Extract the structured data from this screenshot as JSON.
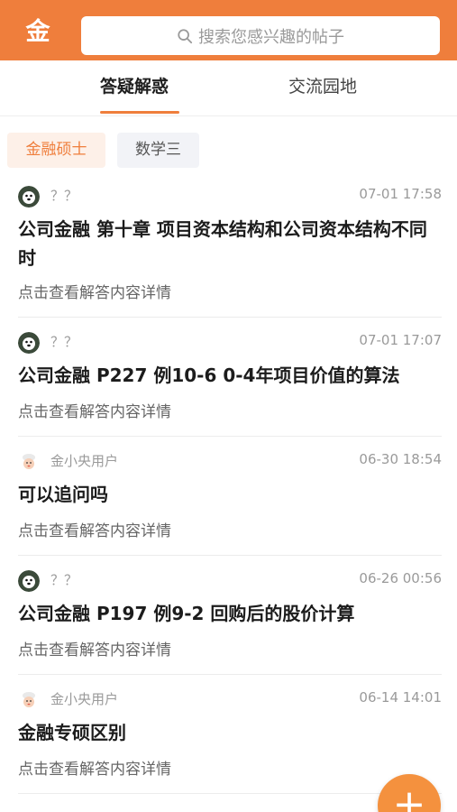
{
  "header": {
    "logo_text": "金",
    "search_placeholder": "搜索您感兴趣的帖子",
    "brand_color": "#ef7e3c"
  },
  "tabs": [
    {
      "label": "答疑解惑",
      "active": true
    },
    {
      "label": "交流园地",
      "active": false
    }
  ],
  "chips": [
    {
      "label": "金融硕士",
      "selected": true
    },
    {
      "label": "数学三",
      "selected": false
    }
  ],
  "posts": [
    {
      "avatar_icon": "dog-avatar-icon",
      "author": "？？",
      "time": "07-01 17:58",
      "title": "公司金融 第十章 项目资本结构和公司资本结构不同时",
      "desc": "点击查看解答内容详情"
    },
    {
      "avatar_icon": "dog-avatar-icon",
      "author": "？？",
      "time": "07-01 17:07",
      "title": "公司金融 P227 例10-6 0-4年项目价值的算法",
      "desc": "点击查看解答内容详情"
    },
    {
      "avatar_icon": "chef-avatar-icon",
      "author": "金小央用户",
      "time": "06-30 18:54",
      "title": "可以追问吗",
      "desc": "点击查看解答内容详情"
    },
    {
      "avatar_icon": "dog-avatar-icon",
      "author": "？？",
      "time": "06-26 00:56",
      "title": "公司金融 P197 例9-2 回购后的股价计算",
      "desc": "点击查看解答内容详情"
    },
    {
      "avatar_icon": "chef-avatar-icon",
      "author": "金小央用户",
      "time": "06-14 14:01",
      "title": "金融专硕区别",
      "desc": "点击查看解答内容详情"
    }
  ],
  "fab": {
    "label": "+",
    "icon": "plus-icon"
  }
}
